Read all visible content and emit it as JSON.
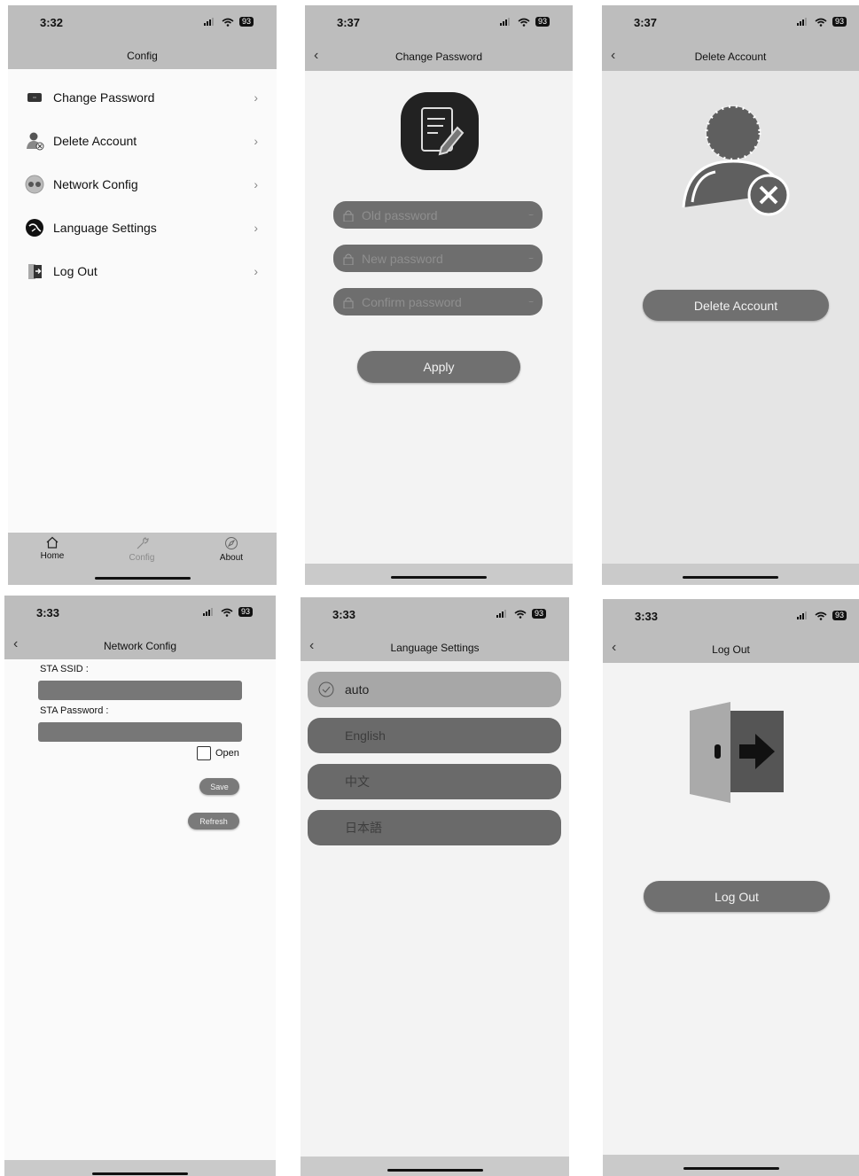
{
  "status": {
    "time_a": "3:32",
    "time_b": "3:37",
    "time_c": "3:33",
    "battery": "93"
  },
  "config": {
    "title": "Config",
    "items": [
      {
        "label": "Change Password",
        "icon": "wallet-icon"
      },
      {
        "label": "Delete Account",
        "icon": "user-remove-icon"
      },
      {
        "label": "Network Config",
        "icon": "network-icon"
      },
      {
        "label": "Language Settings",
        "icon": "language-icon"
      },
      {
        "label": "Log Out",
        "icon": "logout-door-icon"
      }
    ],
    "tabs": [
      {
        "label": "Home",
        "icon": "home-icon"
      },
      {
        "label": "Config",
        "icon": "wrench-icon"
      },
      {
        "label": "About",
        "icon": "compass-icon"
      }
    ]
  },
  "change_password": {
    "title": "Change Password",
    "old_placeholder": "Old password",
    "new_placeholder": "New password",
    "confirm_placeholder": "Confirm password",
    "apply_label": "Apply"
  },
  "delete_account": {
    "title": "Delete Account",
    "button_label": "Delete Account"
  },
  "network_config": {
    "title": "Network Config",
    "ssid_label": "STA SSID :",
    "password_label": "STA Password :",
    "open_label": "Open",
    "save_label": "Save",
    "refresh_label": "Refresh"
  },
  "language_settings": {
    "title": "Language Settings",
    "options": [
      "auto",
      "English",
      "中文",
      "日本語"
    ],
    "selected": "auto"
  },
  "log_out": {
    "title": "Log Out",
    "button_label": "Log Out"
  }
}
